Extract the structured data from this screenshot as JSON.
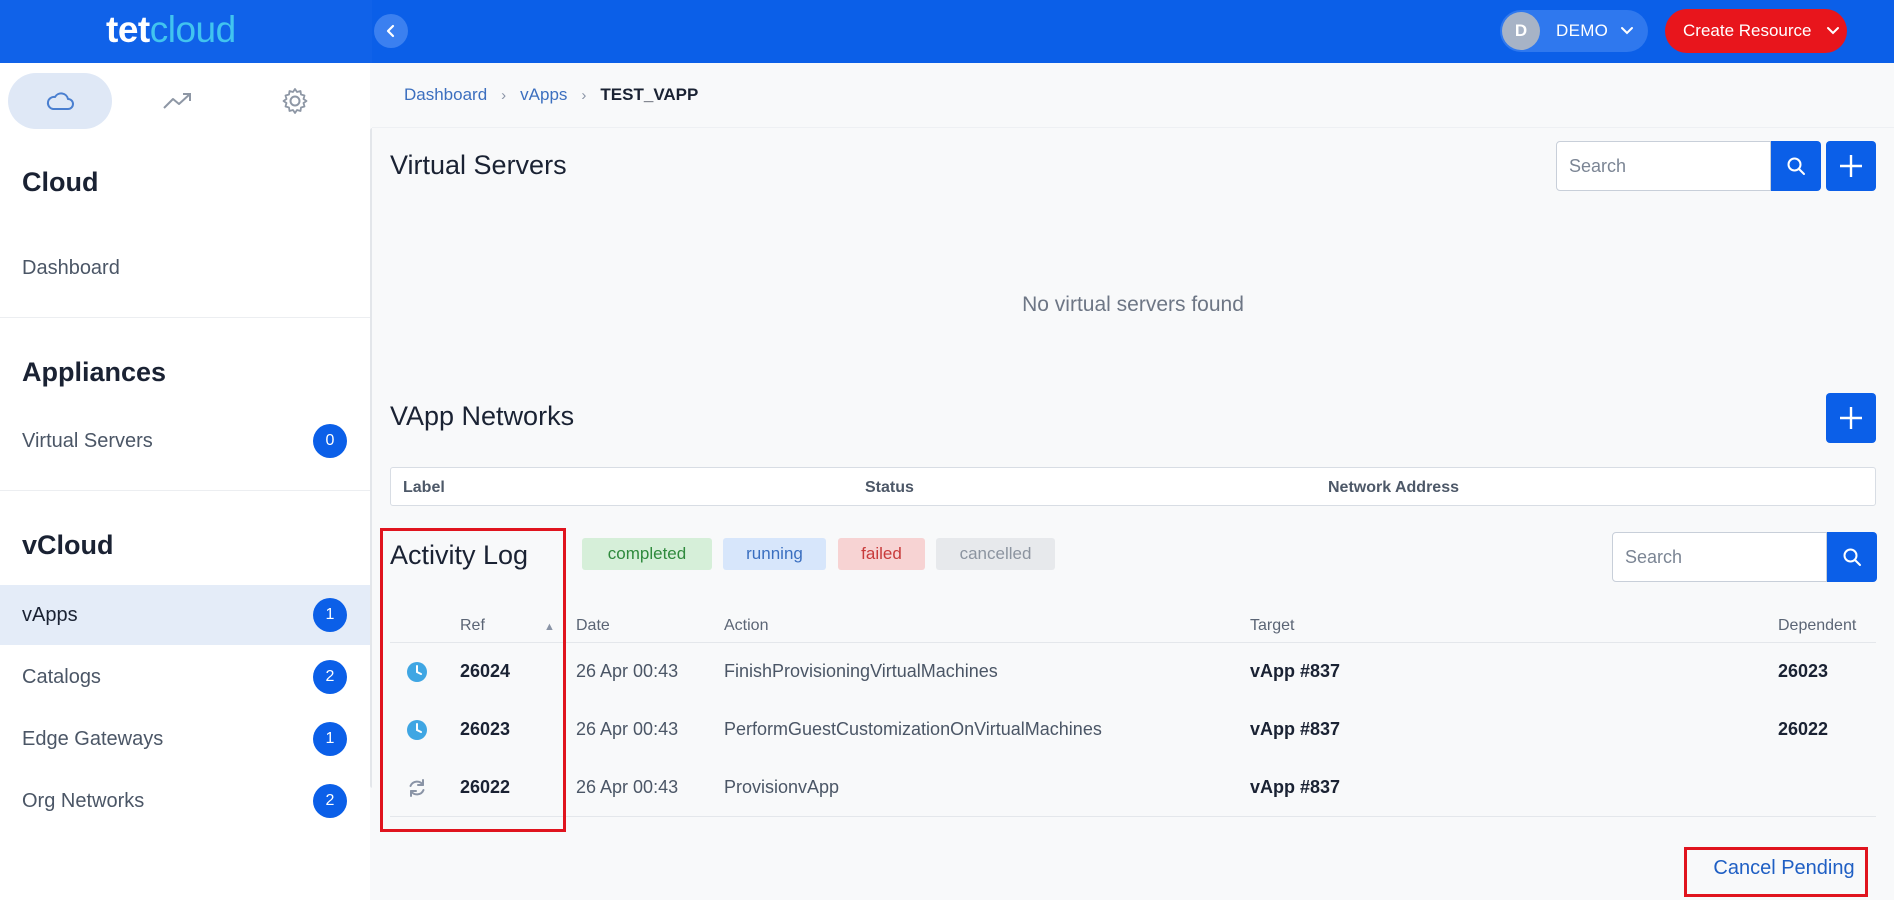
{
  "brand": {
    "logo_part1": "tet",
    "logo_part2": "cloud"
  },
  "header": {
    "user": {
      "initial": "D",
      "name": "DEMO"
    },
    "create_button": "Create Resource"
  },
  "sidebar": {
    "tabs": [
      {
        "icon": "cloud-icon"
      },
      {
        "icon": "trend-icon"
      },
      {
        "icon": "gear-icon"
      }
    ],
    "sections": [
      {
        "title": "Cloud",
        "items": [
          {
            "label": "Dashboard"
          }
        ]
      },
      {
        "title": "Appliances",
        "items": [
          {
            "label": "Virtual Servers",
            "count": "0"
          }
        ]
      },
      {
        "title": "vCloud",
        "items": [
          {
            "label": "vApps",
            "count": "1"
          },
          {
            "label": "Catalogs",
            "count": "2"
          },
          {
            "label": "Edge Gateways",
            "count": "1"
          },
          {
            "label": "Org Networks",
            "count": "2"
          }
        ]
      }
    ]
  },
  "breadcrumb": {
    "items": [
      "Dashboard",
      "vApps"
    ],
    "current": "TEST_VAPP",
    "separator": "›"
  },
  "virtual_servers": {
    "title": "Virtual Servers",
    "search_placeholder": "Search",
    "empty_message": "No virtual servers found"
  },
  "vapp_networks": {
    "title": "VApp Networks",
    "columns": [
      "Label",
      "Status",
      "Network Address"
    ]
  },
  "activity_log": {
    "title": "Activity Log",
    "filters": [
      "completed",
      "running",
      "failed",
      "cancelled"
    ],
    "search_placeholder": "Search",
    "sort_indicator": "▲",
    "columns": [
      "Ref",
      "Date",
      "Action",
      "Target",
      "Dependent"
    ],
    "rows": [
      {
        "status": "clock-icon",
        "ref": "26024",
        "date": "26 Apr 00:43",
        "action": "FinishProvisioningVirtualMachines",
        "target": "vApp #837",
        "dependent": "26023"
      },
      {
        "status": "clock-icon",
        "ref": "26023",
        "date": "26 Apr 00:43",
        "action": "PerformGuestCustomizationOnVirtualMachines",
        "target": "vApp #837",
        "dependent": "26022"
      },
      {
        "status": "refresh-icon",
        "ref": "26022",
        "date": "26 Apr 00:43",
        "action": "ProvisionvApp",
        "target": "vApp #837",
        "dependent": ""
      }
    ],
    "cancel_button": "Cancel Pending"
  },
  "colors": {
    "primary": "#0b5fe8",
    "danger": "#e8151c",
    "accent": "#41c4ef",
    "highlight": "#e0141e"
  }
}
